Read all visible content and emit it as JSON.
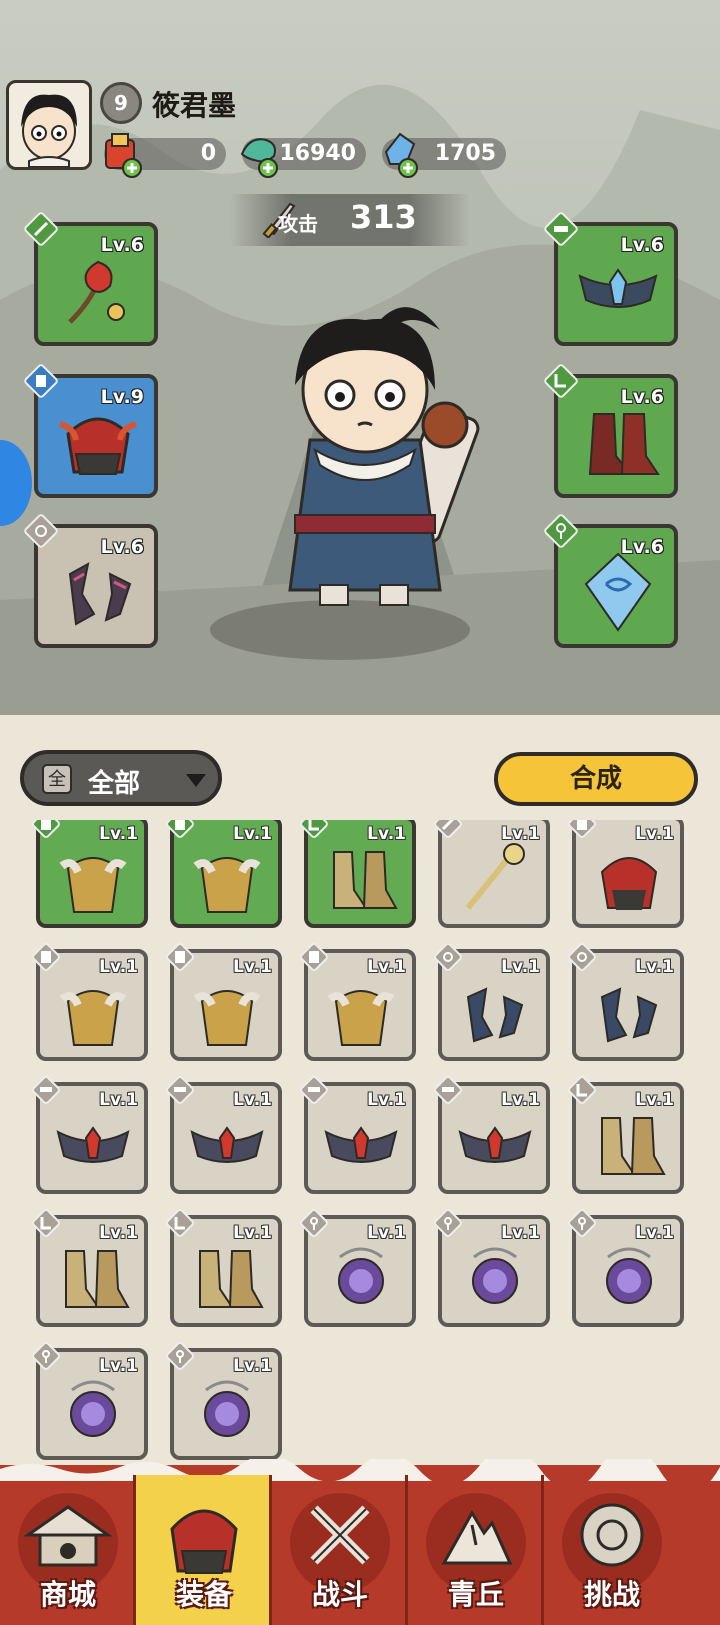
{
  "player": {
    "level": "9",
    "name": "筱君墨"
  },
  "currencies": [
    {
      "icon": "gift-bag-icon",
      "value": "0"
    },
    {
      "icon": "jade-dragon-icon",
      "value": "16940"
    },
    {
      "icon": "blue-crystal-icon",
      "value": "1705"
    }
  ],
  "attack": {
    "label": "攻击",
    "value": "313"
  },
  "equipped": [
    {
      "slot": "weapon",
      "level": "Lv.6",
      "rarity": "green"
    },
    {
      "slot": "helmet",
      "level": "Lv.9",
      "rarity": "blue"
    },
    {
      "slot": "gloves",
      "level": "Lv.6",
      "rarity": "gray"
    },
    {
      "slot": "belt",
      "level": "Lv.6",
      "rarity": "green"
    },
    {
      "slot": "boots",
      "level": "Lv.6",
      "rarity": "green"
    },
    {
      "slot": "amulet",
      "level": "Lv.6",
      "rarity": "green"
    }
  ],
  "filter": {
    "icon_text": "全",
    "label": "全部"
  },
  "merge_button": "合成",
  "inventory": [
    {
      "level": "Lv.1",
      "rarity": "green",
      "slot": "armor"
    },
    {
      "level": "Lv.1",
      "rarity": "green",
      "slot": "armor"
    },
    {
      "level": "Lv.1",
      "rarity": "green",
      "slot": "boots"
    },
    {
      "level": "Lv.1",
      "rarity": "gray",
      "slot": "weapon"
    },
    {
      "level": "Lv.1",
      "rarity": "gray",
      "slot": "helmet"
    },
    {
      "level": "Lv.1",
      "rarity": "gray",
      "slot": "armor"
    },
    {
      "level": "Lv.1",
      "rarity": "gray",
      "slot": "armor"
    },
    {
      "level": "Lv.1",
      "rarity": "gray",
      "slot": "armor"
    },
    {
      "level": "Lv.1",
      "rarity": "gray",
      "slot": "gloves"
    },
    {
      "level": "Lv.1",
      "rarity": "gray",
      "slot": "gloves"
    },
    {
      "level": "Lv.1",
      "rarity": "gray",
      "slot": "belt"
    },
    {
      "level": "Lv.1",
      "rarity": "gray",
      "slot": "belt"
    },
    {
      "level": "Lv.1",
      "rarity": "gray",
      "slot": "belt"
    },
    {
      "level": "Lv.1",
      "rarity": "gray",
      "slot": "belt"
    },
    {
      "level": "Lv.1",
      "rarity": "gray",
      "slot": "boots"
    },
    {
      "level": "Lv.1",
      "rarity": "gray",
      "slot": "boots"
    },
    {
      "level": "Lv.1",
      "rarity": "gray",
      "slot": "boots"
    },
    {
      "level": "Lv.1",
      "rarity": "gray",
      "slot": "amulet"
    },
    {
      "level": "Lv.1",
      "rarity": "gray",
      "slot": "amulet"
    },
    {
      "level": "Lv.1",
      "rarity": "gray",
      "slot": "amulet"
    },
    {
      "level": "Lv.1",
      "rarity": "gray",
      "slot": "amulet"
    },
    {
      "level": "Lv.1",
      "rarity": "gray",
      "slot": "amulet"
    }
  ],
  "nav": [
    {
      "label": "商城",
      "icon": "shop-pavilion-icon",
      "active": false
    },
    {
      "label": "装备",
      "icon": "helmet-icon",
      "active": true
    },
    {
      "label": "战斗",
      "icon": "crossed-swords-icon",
      "active": false
    },
    {
      "label": "青丘",
      "icon": "mountain-icon",
      "active": false
    },
    {
      "label": "挑战",
      "icon": "challenge-orb-icon",
      "active": false
    }
  ],
  "colors": {
    "green": "#5fa84f",
    "blue": "#4a8fd0",
    "gray": "#c9c1b2",
    "merge": "#f6c438",
    "nav": "#b53a2a",
    "nav_active": "#f4d14a"
  }
}
